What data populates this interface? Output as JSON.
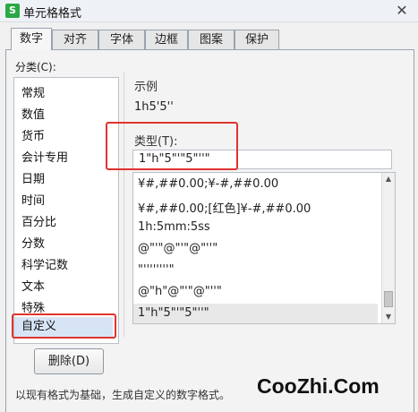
{
  "window": {
    "app_icon": "S",
    "title": "单元格格式",
    "close": "✕"
  },
  "tabs": [
    {
      "label": "数字"
    },
    {
      "label": "对齐"
    },
    {
      "label": "字体"
    },
    {
      "label": "边框"
    },
    {
      "label": "图案"
    },
    {
      "label": "保护"
    }
  ],
  "category": {
    "label": "分类(C):",
    "items": [
      "常规",
      "数值",
      "货币",
      "会计专用",
      "日期",
      "时间",
      "百分比",
      "分数",
      "科学记数",
      "文本",
      "特殊",
      "自定义"
    ],
    "selected": "自定义"
  },
  "delete_button": "删除(D)",
  "sample": {
    "label": "示例",
    "value": "1h5'5''"
  },
  "type": {
    "label": "类型(T):",
    "value": "1\"h\"5\"'\"5\"''\""
  },
  "formats": [
    "¥#,##0.00;¥-#,##0.00",
    "¥#,##0.00;[红色]¥-#,##0.00",
    "1h:5mm:5ss",
    "@\"'\"@\"'\"@\"''\"",
    "\"''''''''\"",
    "@\"h\"@\"'\"@\"''\"",
    "1\"h\"5\"'\"5\"''\""
  ],
  "hint": "以现有格式为基础，生成自定义的数字格式。",
  "watermark": "CooZhi.Com",
  "colors": {
    "highlight": "#e0342e",
    "selected_category": "#d7e4f5",
    "app_icon": "#2aa845"
  }
}
